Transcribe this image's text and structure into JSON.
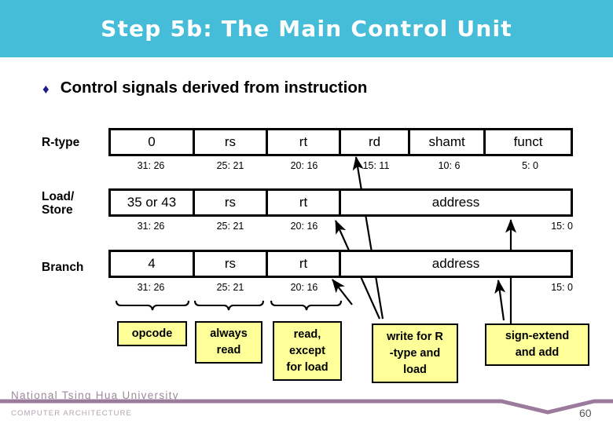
{
  "slide": {
    "title": "Step 5b: The Main Control Unit",
    "banner_color": "#45bdd8",
    "bullet": {
      "glyph": "♦",
      "text": "Control signals derived from instruction",
      "color": "#1c1c8c"
    }
  },
  "formats": [
    {
      "label": "R-type",
      "fields": [
        "0",
        "rs",
        "rt",
        "rd",
        "shamt",
        "funct"
      ],
      "bits": [
        "31: 26",
        "25: 21",
        "20: 16",
        "15: 11",
        "10: 6",
        "5: 0"
      ]
    },
    {
      "label": "Load/\nStore",
      "label_line1": "Load/",
      "label_line2": "Store",
      "fields": [
        "35 or 43",
        "rs",
        "rt",
        "",
        "address"
      ],
      "bits": [
        "31: 26",
        "25: 21",
        "20: 16",
        "15: 0"
      ]
    },
    {
      "label": "Branch",
      "fields": [
        "4",
        "rs",
        "rt",
        "",
        "address",
        ""
      ],
      "bits": [
        "31: 26",
        "25: 21",
        "20: 16",
        "15: 0"
      ]
    }
  ],
  "notes": [
    {
      "lines": [
        "opcode"
      ]
    },
    {
      "lines": [
        "always",
        "read"
      ]
    },
    {
      "lines": [
        "read,",
        "except",
        "for load"
      ]
    },
    {
      "lines": [
        "write for R",
        "-type and",
        "load"
      ]
    },
    {
      "lines": [
        "sign-extend",
        "and add"
      ]
    }
  ],
  "note_color": "#ffff99",
  "footer": {
    "university": "National  Tsing  Hua  University",
    "course": "COMPUTER  ARCHITECTURE",
    "page_number": "60",
    "rule_color": "#9b7a9b"
  }
}
